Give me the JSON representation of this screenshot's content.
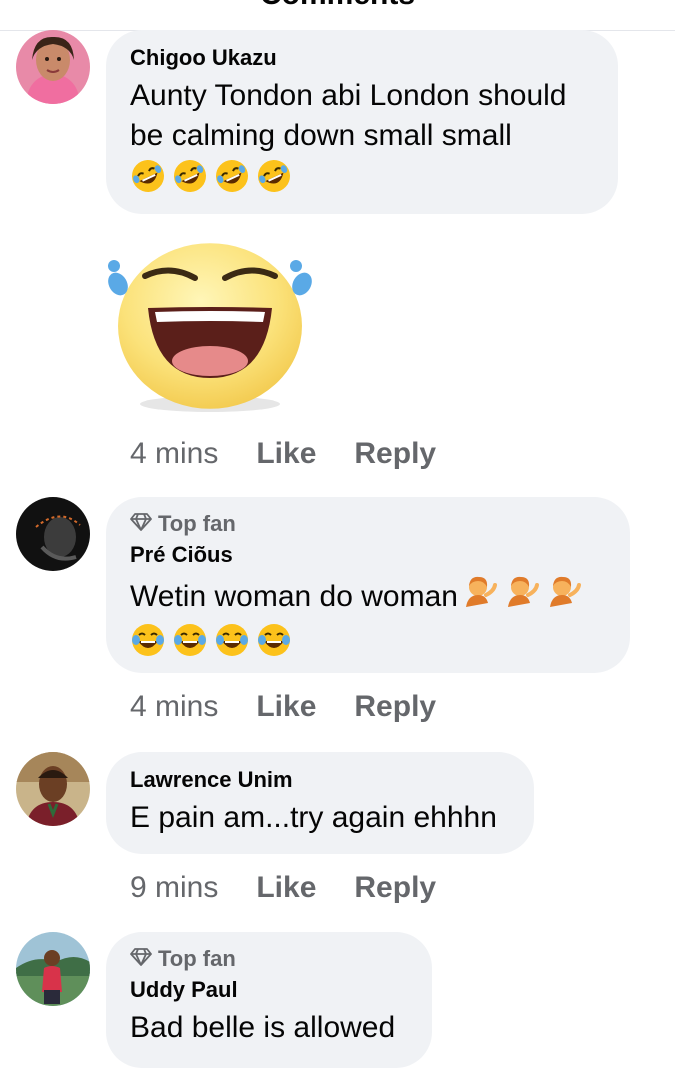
{
  "header": {
    "title": "Comments"
  },
  "comments": [
    {
      "badge": "",
      "author": "Chigoo Ukazu",
      "text": "Aunty Tondon abi London should be calming down small small",
      "emojis": [
        "rolling-on-floor-laughing",
        "rolling-on-floor-laughing",
        "rolling-on-floor-laughing",
        "rolling-on-floor-laughing"
      ],
      "sticker": "laughing-with-tears-sticker",
      "time": "4 mins",
      "like_label": "Like",
      "reply_label": "Reply"
    },
    {
      "badge": "Top fan",
      "author": "Pré Ciõus",
      "text": "Wetin woman do woman",
      "inline_emojis": [
        "woman-tipping-hand",
        "woman-tipping-hand",
        "woman-tipping-hand"
      ],
      "emojis": [
        "face-with-tears-of-joy",
        "face-with-tears-of-joy",
        "face-with-tears-of-joy",
        "face-with-tears-of-joy"
      ],
      "time": "4 mins",
      "like_label": "Like",
      "reply_label": "Reply"
    },
    {
      "badge": "",
      "author": "Lawrence Unim",
      "text": "E pain am...try again ehhhn",
      "time": "9 mins",
      "like_label": "Like",
      "reply_label": "Reply"
    },
    {
      "badge": "Top fan",
      "author": "Uddy Paul",
      "text": "Bad belle is allowed"
    }
  ],
  "colors": {
    "bubble": "#f0f2f5",
    "secondary_text": "#65676b",
    "primary_text": "#050505",
    "emoji_yellow": "#fcc21b",
    "tear_blue": "#5aa9e6"
  }
}
